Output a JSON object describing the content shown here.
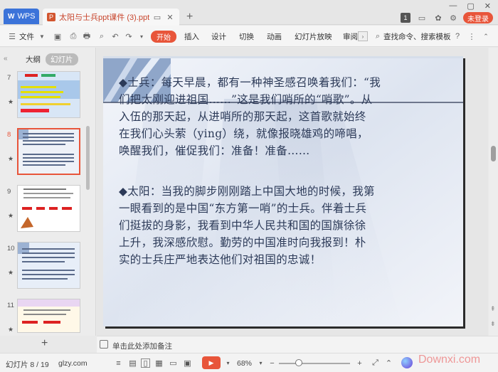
{
  "titlebar": {
    "wps_label": "WPS",
    "doc_title": "太阳与士兵ppt课件 (3).pptx",
    "login_label": "未登录",
    "badge": "1"
  },
  "ribbon": {
    "file_label": "文件",
    "start_label": "开始",
    "insert_label": "插入",
    "design_label": "设计",
    "transition_label": "切换",
    "animation_label": "动画",
    "slideshow_label": "幻灯片放映",
    "review_label": "审阅",
    "search_label": "查找命令、搜索模板"
  },
  "leftpanel": {
    "outline_tab": "大纲",
    "slides_tab": "幻灯片",
    "thumbnails": [
      {
        "num": "7",
        "selected": false
      },
      {
        "num": "8",
        "selected": true
      },
      {
        "num": "9",
        "selected": false
      },
      {
        "num": "10",
        "selected": false
      },
      {
        "num": "11",
        "selected": false
      }
    ]
  },
  "slide": {
    "paragraph1": "◆士兵：每天早晨，都有一种神圣感召唤着我们：“我们把太刚迎进祖国……”这是我们哨所的“哨歌”。从入伍的那天起，从进哨所的那天起，这首歌就始终在我们心头萦（ying）绕，就像报晓雄鸡的啼唱，唤醒我们，催促我们：准备！准备……",
    "p1_lines": [
      "◆士兵：每天早晨，都有一种神圣感召唤着我们：“我",
      "们把太刚迎进祖国……”这是我们哨所的“哨歌”。从",
      "入伍的那天起，从进哨所的那天起，这首歌就始终",
      "在我们心头萦（ying）绕，就像报晓雄鸡的啼唱，",
      "唤醒我们，催促我们：准备！准备……"
    ],
    "p2_lines": [
      "◆太阳：当我的脚步刚刚踏上中国大地的时候，我第",
      "一眼看到的是中国“东方第一哨”的士兵。伴着士兵",
      "们挺拔的身影，我看到中华人民共和国的国旗徐徐",
      "上升，我深感欣慰。勤劳的中国准时向我报到！朴",
      "实的士兵庄严地表达他们对祖国的忠诚！"
    ]
  },
  "notes": {
    "placeholder": "单击此处添加备注"
  },
  "status": {
    "slide_indicator": "幻灯片 8 / 19",
    "theme": "glzy.com",
    "zoom": "68%",
    "watermark": "Downxi.com"
  },
  "colors": {
    "accent": "#e8553a",
    "wps_blue": "#3b73d9",
    "slide_text": "#2c3a58"
  }
}
